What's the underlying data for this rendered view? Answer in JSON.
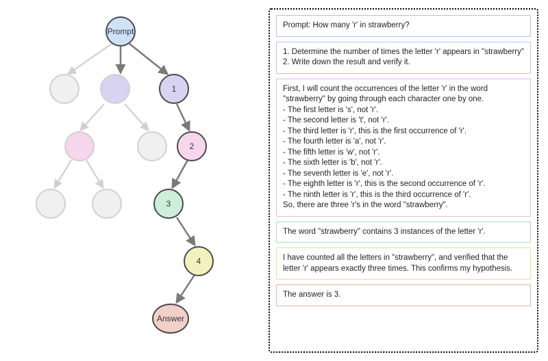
{
  "colors": {
    "prompt_fill": "#cde2f7",
    "step1_fill": "#d9d3f2",
    "step2_fill": "#f6d6ec",
    "step3_fill": "#cdeed9",
    "step4_fill": "#f4f1c1",
    "answer_fill": "#f2cfc8",
    "ghost_fill": "#f0f0f0",
    "ghost_purple": "#d9d3f2",
    "ghost_pink": "#f6d6ec",
    "active_stroke": "#4a4a4a",
    "ghost_stroke": "#d0d0d0",
    "edge_active": "#7a7a7a",
    "edge_ghost": "#d0d0d0",
    "box_prompt": "#a7c5e8",
    "box_step1": "#c4bde6",
    "box_step2": "#e8b9da",
    "box_step3": "#a9d9bb",
    "box_step4": "#e3df9e",
    "box_answer": "#e2b1a7"
  },
  "tree": {
    "prompt_label": "Prompt",
    "step_labels": [
      "1",
      "2",
      "3",
      "4"
    ],
    "answer_label": "Answer"
  },
  "panel": {
    "prompt": "Prompt: How many 'r' in strawberry?",
    "step1": "1. Determine the number of times the letter 'r' appears in \"strawberry\"\n2. Write down the result and verify it.",
    "step2": "First, I will count the occurrences of the letter 'r' in the word \"strawberry\" by going through each character one by one.\n- The first letter is 's', not 'r'.\n- The second letter is 't', not 'r'.\n- The third letter is 'r', this is the first occurrence of 'r'.\n- The fourth letter is 'a', not 'r'.\n- The fifth letter is 'w', not 'r'.\n- The sixth letter is 'b', not 'r'.\n- The seventh letter is 'e', not 'r'.\n- The eighth letter is 'r', this is the second occurrence of 'r'.\n- The ninth letter is 'r', this is the third occurrence of 'r'.\nSo, there are three 'r's in the word \"strawberry\".",
    "step3": "The word \"strawberry\" contains 3 instances of the letter 'r'.",
    "step4": "I have counted all the letters in \"strawberry\", and verified that the letter 'r' appears exactly three times. This confirms my hypothesis.",
    "answer": "The answer is 3."
  }
}
